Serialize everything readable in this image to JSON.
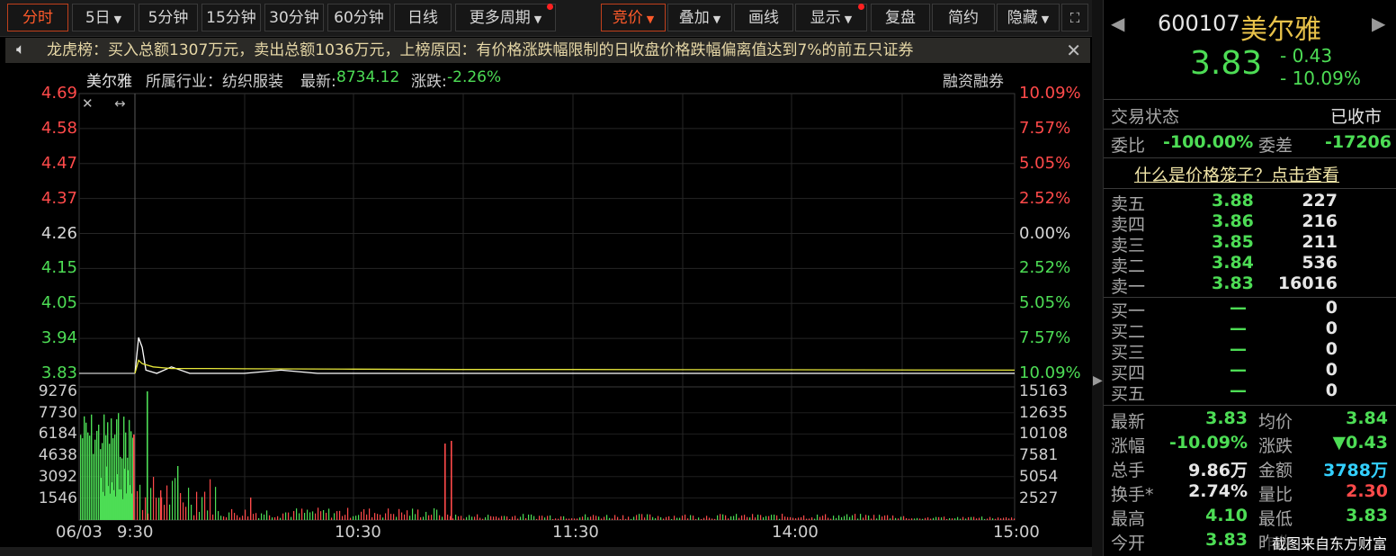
{
  "toolbar": {
    "tabs": [
      "分时",
      "5日",
      "5分钟",
      "15分钟",
      "30分钟",
      "60分钟",
      "日线",
      "更多周期"
    ],
    "right_buttons": [
      "竞价",
      "叠加",
      "画线",
      "显示",
      "复盘",
      "简约",
      "隐藏"
    ]
  },
  "banner": {
    "text": "龙虎榜：买入总额1307万元，卖出总额1036万元，上榜原因：有价格涨跌幅限制的日收盘价格跌幅偏离值达到7%的前五只证券",
    "close": "✕"
  },
  "info": {
    "name": "美尔雅",
    "industry": "所属行业：纺织服装",
    "latest_label": "最新:",
    "latest_value": "8734.12",
    "change_label": "涨跌:",
    "change_value": "-2.26%",
    "margin": "融资融券"
  },
  "price_axis": {
    "left": [
      "4.69",
      "4.58",
      "4.47",
      "4.37",
      "4.26",
      "4.15",
      "4.05",
      "3.94",
      "3.83"
    ],
    "right": [
      "10.09%",
      "7.57%",
      "5.05%",
      "2.52%",
      "0.00%",
      "2.52%",
      "5.05%",
      "7.57%",
      "10.09%"
    ]
  },
  "volume_axis": {
    "left": [
      "9276",
      "7730",
      "6184",
      "4638",
      "3092",
      "1546"
    ],
    "right": [
      "15163",
      "12635",
      "10108",
      "7581",
      "5054",
      "2527"
    ]
  },
  "time_axis": [
    "06/03",
    "9:30",
    "10:30",
    "11:30",
    "14:00",
    "15:00"
  ],
  "chart_data": {
    "type": "line",
    "ylim": [
      3.83,
      4.69
    ],
    "x_range": [
      "9:30",
      "15:00"
    ],
    "series": [
      {
        "name": "价格",
        "color": "#ffffff",
        "x": [
          "9:30",
          "9:31",
          "9:32",
          "9:33",
          "9:36",
          "9:40",
          "9:45",
          "9:50",
          "10:00",
          "10:10",
          "10:20",
          "10:30",
          "11:30",
          "15:00"
        ],
        "y": [
          3.83,
          3.94,
          3.91,
          3.84,
          3.83,
          3.85,
          3.83,
          3.83,
          3.83,
          3.84,
          3.83,
          3.83,
          3.83,
          3.83
        ]
      },
      {
        "name": "均价",
        "color": "#e8e83a",
        "x": [
          "9:30",
          "9:31",
          "9:32",
          "9:35",
          "9:40",
          "9:50",
          "10:00",
          "10:30",
          "11:00",
          "11:30",
          "14:00",
          "15:00"
        ],
        "y": [
          3.83,
          3.87,
          3.86,
          3.85,
          3.845,
          3.845,
          3.844,
          3.843,
          3.842,
          3.842,
          3.841,
          3.84
        ]
      }
    ]
  },
  "panel": {
    "code": "600107",
    "name": "美尔雅",
    "price": "3.83",
    "change": "- 0.43",
    "change_pct": "- 10.09%",
    "status_label": "交易状态",
    "status_value": "已收市",
    "wb_label": "委比",
    "wb_value": "-100.00%",
    "wc_label": "委差",
    "wc_value": "-17206",
    "cage_link": "什么是价格笼子？点击查看",
    "sells": [
      {
        "label": "卖五",
        "price": "3.88",
        "vol": "227"
      },
      {
        "label": "卖四",
        "price": "3.86",
        "vol": "216"
      },
      {
        "label": "卖三",
        "price": "3.85",
        "vol": "211"
      },
      {
        "label": "卖二",
        "price": "3.84",
        "vol": "536"
      },
      {
        "label": "卖一",
        "price": "3.83",
        "vol": "16016"
      }
    ],
    "buys": [
      {
        "label": "买一",
        "price": "—",
        "vol": "0"
      },
      {
        "label": "买二",
        "price": "—",
        "vol": "0"
      },
      {
        "label": "买三",
        "price": "—",
        "vol": "0"
      },
      {
        "label": "买四",
        "price": "—",
        "vol": "0"
      },
      {
        "label": "买五",
        "price": "—",
        "vol": "0"
      }
    ],
    "stats": [
      {
        "l1": "最新",
        "v1": "3.83",
        "c1": "green",
        "l2": "均价",
        "v2": "3.84",
        "c2": "green"
      },
      {
        "l1": "涨幅",
        "v1": "-10.09%",
        "c1": "green",
        "l2": "涨跌",
        "v2": "▼0.43",
        "c2": "green"
      },
      {
        "l1": "总手",
        "v1": "9.86万",
        "c1": "white",
        "l2": "金额",
        "v2": "3788万",
        "c2": "cyan"
      },
      {
        "l1": "换手*",
        "v1": "2.74%",
        "c1": "white",
        "l2": "量比",
        "v2": "2.30",
        "c2": "red"
      },
      {
        "l1": "最高",
        "v1": "4.10",
        "c1": "green",
        "l2": "最低",
        "v2": "3.83",
        "c2": "green"
      },
      {
        "l1": "今开",
        "v1": "3.83",
        "c1": "green",
        "l2": "昨收",
        "v2": "",
        "c2": "white"
      }
    ],
    "watermark": "截图来自东方财富"
  },
  "colors": {
    "up": "#ff4a4a",
    "down": "#4ddd55",
    "avg": "#e8e83a",
    "grid": "#2a2a2a",
    "accent": "#ff5a2a"
  }
}
